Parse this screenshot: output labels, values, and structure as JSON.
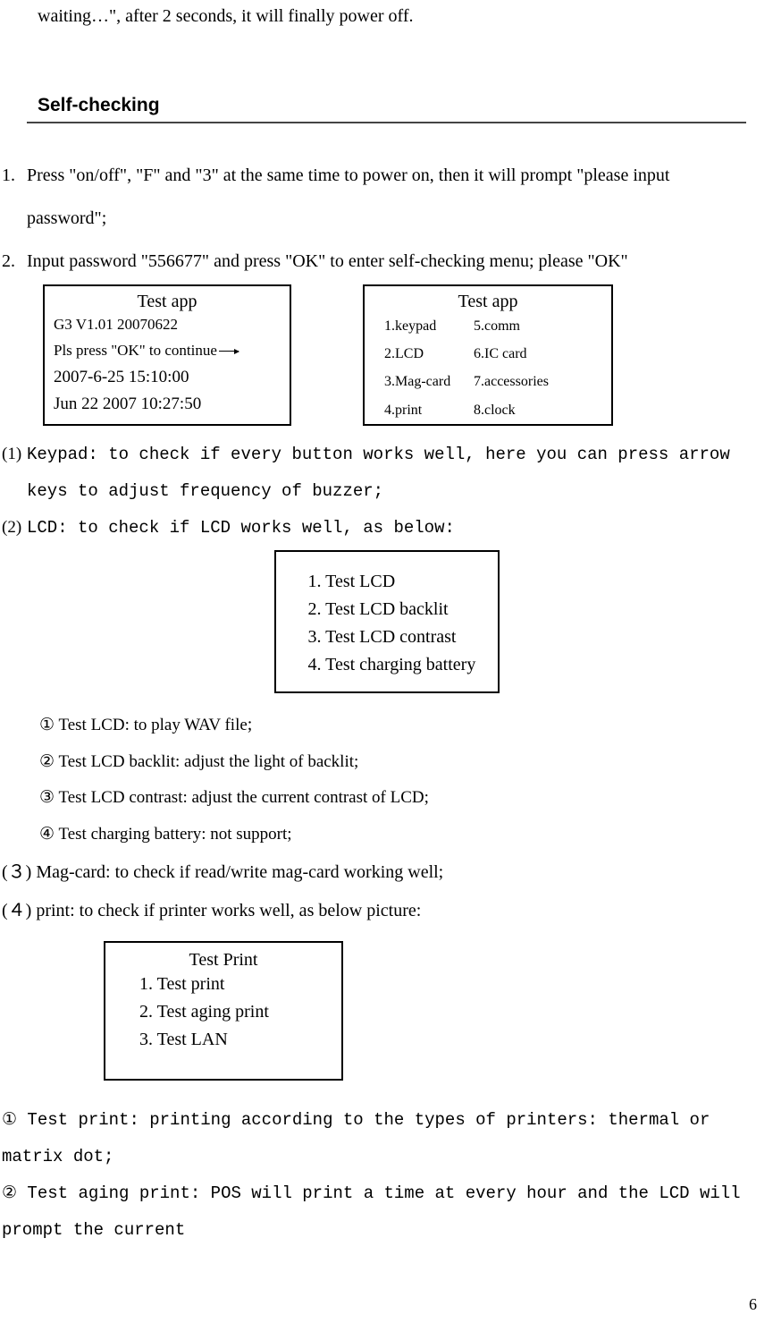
{
  "top_fragment": "waiting…\", after 2 seconds, it will finally power off.",
  "section_title": "Self-checking",
  "ol1": "Press \"on/off\", \"F\" and \"3\" at the same time to power on, then it will prompt \"please input password\";",
  "ol2": "Input password  \"556677\" and press \"OK\" to enter self-checking menu; please \"OK\"",
  "box1": {
    "title": "Test app",
    "line1": "G3 V1.01     20070622",
    "line2": "Pls press \"OK\" to continue",
    "line3": "2007-6-25        15:10:00",
    "line4": "Jun 22 2007    10:27:50"
  },
  "box2": {
    "title": "Test app",
    "rows": [
      {
        "c1": "1.keypad",
        "c2": "5.comm"
      },
      {
        "c1": "2.LCD",
        "c2": "6.IC card"
      },
      {
        "c1": "3.Mag-card",
        "c2": "7.accessories"
      },
      {
        "c1": "4.print",
        "c2": "8.clock"
      }
    ]
  },
  "p1_label": "(1)",
  "p1_text": "Keypad: to check if every button works well, here you can press arrow keys to adjust frequency of buzzer;",
  "p2_label": "(2)",
  "p2_text": "LCD: to check if LCD works well, as below:",
  "box3": {
    "l1": "1. Test LCD",
    "l2": "2. Test LCD backlit",
    "l3": "3. Test LCD contrast",
    "l4": "4. Test charging battery"
  },
  "sub1": "① Test LCD: to play WAV file",
  "sub1_tail": ";",
  "sub2": "② Test LCD backlit: adjust the light of backlit;",
  "sub3": "③ Test LCD contrast: adjust the current contrast of LCD;",
  "sub4": "④ Test charging battery: not support;",
  "p3": "(３) Mag-card: to check if read/write mag-card working well;",
  "p4": "(４) print: to check if printer works well, as below picture:",
  "box4": {
    "title": "Test Print",
    "l1": "1. Test print",
    "l2": "2. Test aging print",
    "l3": "3. Test LAN"
  },
  "tail1": "①  Test print:  printing according to the types of printers: thermal or matrix dot;",
  "tail2": "②   Test aging print: POS will print a time at every hour and the LCD will prompt the current",
  "page_number": "6"
}
